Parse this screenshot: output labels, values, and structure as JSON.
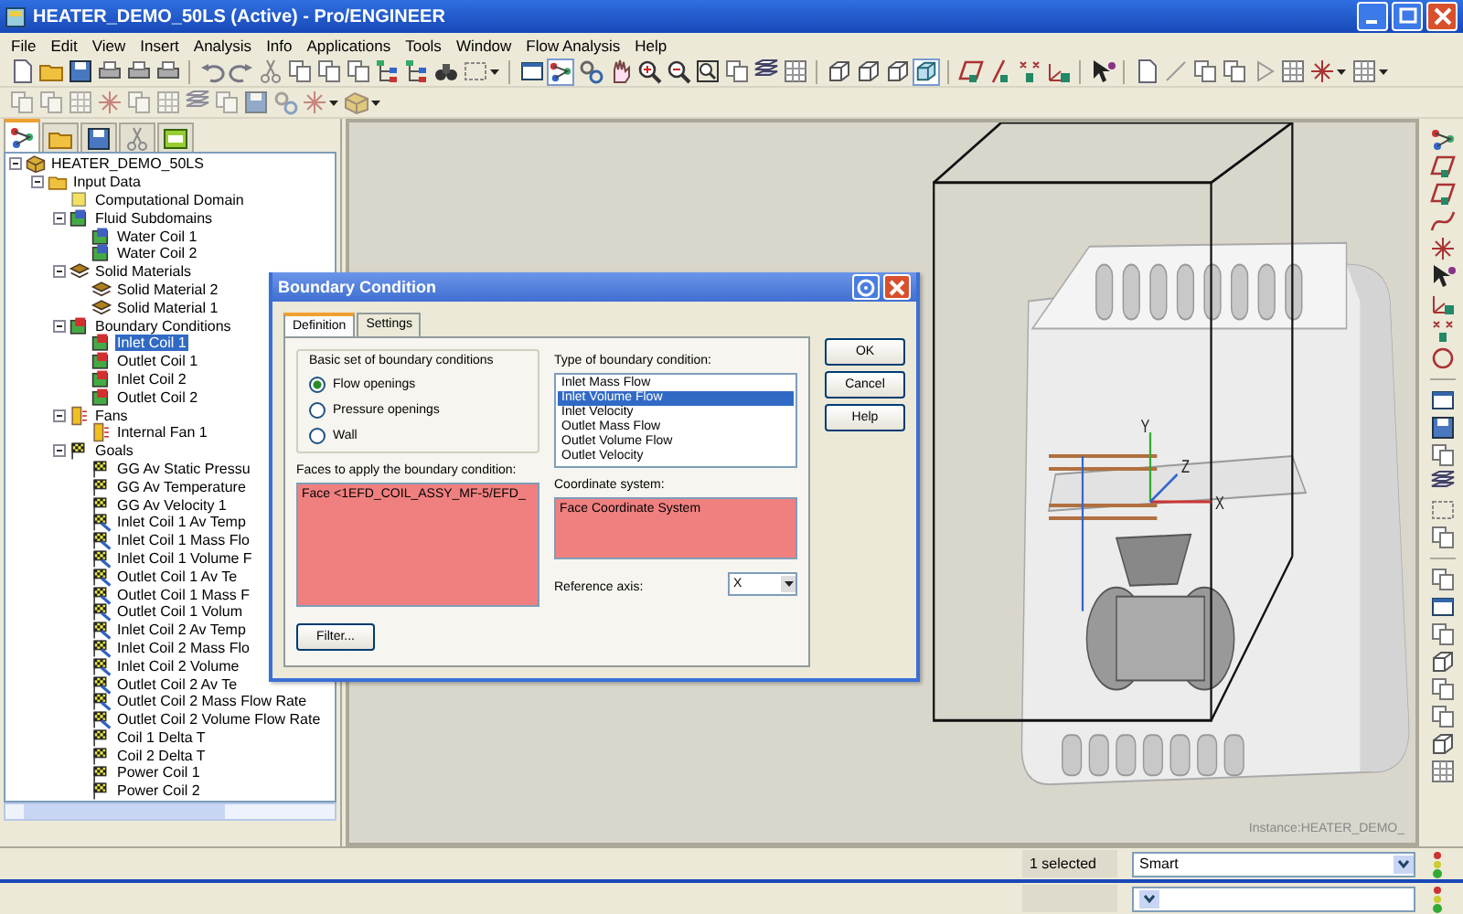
{
  "window": {
    "title": "HEATER_DEMO_50LS (Active) - Pro/ENGINEER"
  },
  "menu": [
    "File",
    "Edit",
    "View",
    "Insert",
    "Analysis",
    "Info",
    "Applications",
    "Tools",
    "Window",
    "Flow Analysis",
    "Help"
  ],
  "tree_tabs": [
    {
      "selected": true
    },
    {
      "selected": false
    },
    {
      "selected": false
    },
    {
      "selected": false
    },
    {
      "selected": false
    }
  ],
  "tree": [
    {
      "label": "HEATER_DEMO_50LS",
      "kind": "part",
      "expanded": true,
      "selected": false,
      "children": [
        {
          "label": "Input Data",
          "kind": "folder",
          "expanded": true,
          "selected": false,
          "children": [
            {
              "label": "Computational Domain",
              "kind": "domain",
              "selected": false
            },
            {
              "label": "Fluid Subdomains",
              "kind": "fluid",
              "expanded": true,
              "selected": false,
              "children": [
                {
                  "label": "Water Coil 1",
                  "kind": "fluid",
                  "selected": false
                },
                {
                  "label": "Water Coil 2",
                  "kind": "fluid",
                  "selected": false
                }
              ]
            },
            {
              "label": "Solid Materials",
              "kind": "solid",
              "expanded": true,
              "selected": false,
              "children": [
                {
                  "label": "Solid Material 2",
                  "kind": "solid",
                  "selected": false
                },
                {
                  "label": "Solid Material 1",
                  "kind": "solid",
                  "selected": false
                }
              ]
            },
            {
              "label": "Boundary Conditions",
              "kind": "boundary",
              "expanded": true,
              "selected": false,
              "children": [
                {
                  "label": "Inlet Coil 1",
                  "kind": "boundary",
                  "selected": true
                },
                {
                  "label": "Outlet Coil 1",
                  "kind": "boundary",
                  "selected": false
                },
                {
                  "label": "Inlet Coil 2",
                  "kind": "boundary",
                  "selected": false
                },
                {
                  "label": "Outlet Coil 2",
                  "kind": "boundary",
                  "selected": false
                }
              ]
            },
            {
              "label": "Fans",
              "kind": "fan",
              "expanded": true,
              "selected": false,
              "children": [
                {
                  "label": "Internal Fan 1",
                  "kind": "fan",
                  "selected": false
                }
              ]
            },
            {
              "label": "Goals",
              "kind": "goal",
              "expanded": true,
              "selected": false,
              "children": [
                {
                  "label": "GG Av Static Pressu",
                  "kind": "goal",
                  "selected": false
                },
                {
                  "label": "GG Av Temperature",
                  "kind": "goal",
                  "selected": false
                },
                {
                  "label": "GG Av Velocity 1",
                  "kind": "goal",
                  "selected": false
                },
                {
                  "label": "Inlet Coil 1 Av Temp",
                  "kind": "surface-goal",
                  "selected": false
                },
                {
                  "label": "Inlet Coil 1 Mass Flo",
                  "kind": "surface-goal",
                  "selected": false
                },
                {
                  "label": "Inlet Coil 1 Volume F",
                  "kind": "surface-goal",
                  "selected": false
                },
                {
                  "label": "Outlet Coil 1 Av Te",
                  "kind": "surface-goal",
                  "selected": false
                },
                {
                  "label": "Outlet Coil 1 Mass F",
                  "kind": "surface-goal",
                  "selected": false
                },
                {
                  "label": "Outlet Coil 1 Volum",
                  "kind": "surface-goal",
                  "selected": false
                },
                {
                  "label": "Inlet Coil 2 Av Temp",
                  "kind": "surface-goal",
                  "selected": false
                },
                {
                  "label": "Inlet Coil 2 Mass Flo",
                  "kind": "surface-goal",
                  "selected": false
                },
                {
                  "label": "Inlet Coil 2 Volume",
                  "kind": "surface-goal",
                  "selected": false
                },
                {
                  "label": "Outlet Coil 2 Av Te",
                  "kind": "surface-goal",
                  "selected": false
                },
                {
                  "label": "Outlet Coil 2 Mass Flow Rate",
                  "kind": "surface-goal",
                  "selected": false
                },
                {
                  "label": "Outlet Coil 2 Volume Flow Rate",
                  "kind": "surface-goal",
                  "selected": false
                },
                {
                  "label": "Coil 1 Delta T",
                  "kind": "equation-goal",
                  "selected": false
                },
                {
                  "label": "Coil 2 Delta T",
                  "kind": "equation-goal",
                  "selected": false
                },
                {
                  "label": "Power Coil 1",
                  "kind": "equation-goal",
                  "selected": false
                },
                {
                  "label": "Power Coil 2",
                  "kind": "equation-goal",
                  "selected": false
                }
              ]
            }
          ]
        }
      ]
    }
  ],
  "viewport": {
    "axis_labels": [
      "Y",
      "Z",
      "X"
    ],
    "instance_label": "Instance:HEATER_DEMO_"
  },
  "dialog": {
    "title": "Boundary Condition",
    "tabs": [
      {
        "label": "Definition",
        "selected": true
      },
      {
        "label": "Settings",
        "selected": false
      }
    ],
    "basic_set": {
      "title": "Basic set of boundary conditions",
      "options": [
        {
          "label": "Flow openings",
          "selected": true
        },
        {
          "label": "Pressure openings",
          "selected": false
        },
        {
          "label": "Wall",
          "selected": false
        }
      ]
    },
    "type": {
      "label": "Type of boundary condition:",
      "items": [
        {
          "label": "Inlet Mass Flow",
          "selected": false
        },
        {
          "label": "Inlet Volume Flow",
          "selected": true
        },
        {
          "label": "Inlet Velocity",
          "selected": false
        },
        {
          "label": "Outlet Mass Flow",
          "selected": false
        },
        {
          "label": "Outlet Volume Flow",
          "selected": false
        },
        {
          "label": "Outlet Velocity",
          "selected": false
        }
      ]
    },
    "faces": {
      "label": "Faces to apply the boundary condition:",
      "items": [
        "Face <1EFD_COIL_ASSY_MF-5/EFD_"
      ]
    },
    "coordinate_system": {
      "label": "Coordinate system:",
      "value": "Face Coordinate System"
    },
    "reference_axis": {
      "label": "Reference axis:",
      "value": "X"
    },
    "filter_button": "Filter...",
    "buttons": [
      "OK",
      "Cancel",
      "Help"
    ]
  },
  "status_bar": {
    "message": "1 selected",
    "filter": "Smart"
  }
}
